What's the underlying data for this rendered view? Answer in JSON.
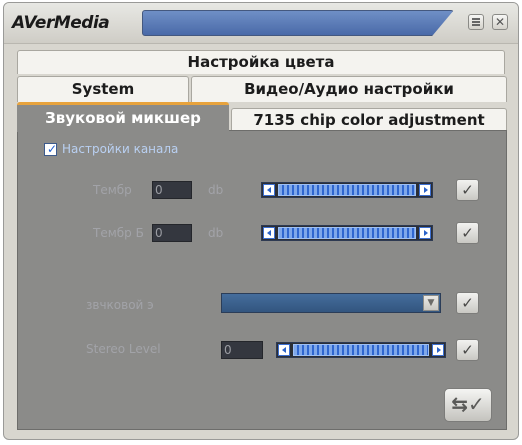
{
  "app": {
    "logo_text": "AVerMedia",
    "caption_text": ""
  },
  "title_buttons": {
    "menu_icon": "menu-icon",
    "close_label": "✕"
  },
  "tabs": {
    "row1": [
      "Настройка цвета"
    ],
    "row2": [
      "System",
      "Видео/Аудио настройки"
    ],
    "row3": [
      "Звуковой микшер",
      "7135 chip color adjustment"
    ],
    "active": "Звуковой микшер"
  },
  "mixer": {
    "channel_settings": {
      "label": "Настройки канала",
      "checked": true
    },
    "rows": [
      {
        "label": "Тембр",
        "value": "0",
        "unit": "db"
      },
      {
        "label": "Тембр Б",
        "value": "0",
        "unit": "db"
      }
    ],
    "sound_effect": {
      "label": "звчковой э",
      "value": ""
    },
    "stereo_level": {
      "label": "Stereo Level",
      "value": "0"
    },
    "apply_icon": "apply-arrow-check-icon",
    "row_apply_icon": "checkmark-icon"
  },
  "colors": {
    "panel": "#8b8b89",
    "active_tab": "#8b8b89",
    "active_tab_accent": "#e8a33d",
    "slider_fill": "#2f66cf"
  }
}
